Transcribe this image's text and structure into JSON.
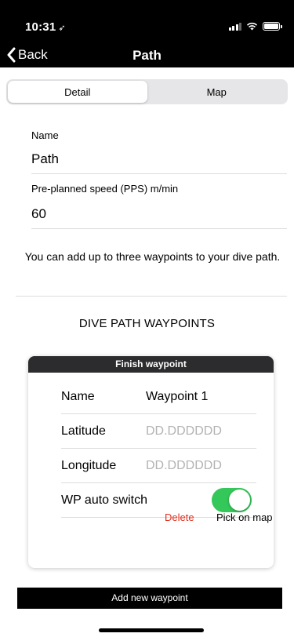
{
  "status_bar": {
    "time": "10:31",
    "location_icon": "location-arrow-icon"
  },
  "nav": {
    "back_label": "Back",
    "title": "Path"
  },
  "tabs": [
    {
      "label": "Detail",
      "active": true
    },
    {
      "label": "Map",
      "active": false
    }
  ],
  "form": {
    "name_label": "Name",
    "name_value": "Path",
    "speed_label": "Pre-planned speed (PPS) m/min",
    "speed_value": "60",
    "info_text": "You can add up to three waypoints to your dive path."
  },
  "section_title": "DIVE PATH WAYPOINTS",
  "waypoint": {
    "header": "Finish waypoint",
    "name_label": "Name",
    "name_value": "Waypoint 1",
    "latitude_label": "Latitude",
    "latitude_placeholder": "DD.DDDDDD",
    "longitude_label": "Longitude",
    "longitude_placeholder": "DD.DDDDDD",
    "auto_switch_label": "WP auto switch",
    "auto_switch_on": true,
    "delete_label": "Delete",
    "pick_label": "Pick on map"
  },
  "add_button_label": "Add new waypoint",
  "colors": {
    "toggle_on": "#34c759",
    "delete": "#e0301e",
    "header_bg": "#2c2c2e"
  }
}
